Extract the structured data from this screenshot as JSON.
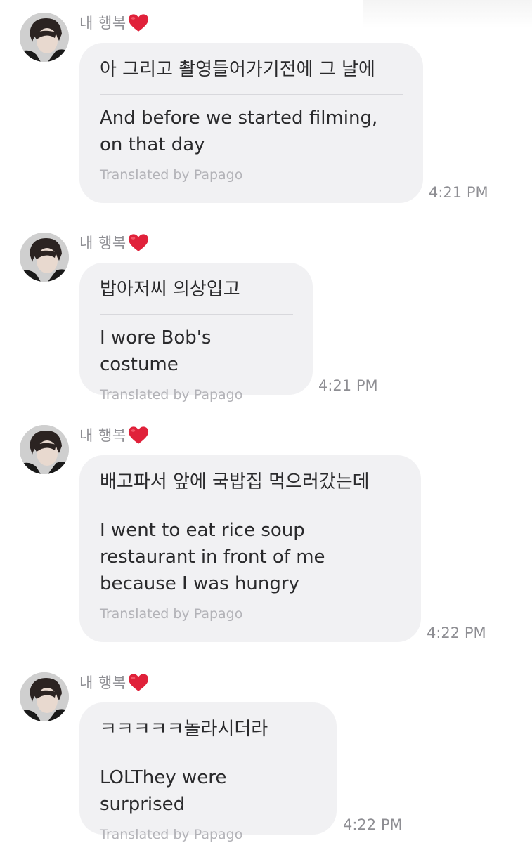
{
  "messages": [
    {
      "sender": "내 행복",
      "sender_emoji": "heart-icon",
      "original": "아 그리고 촬영들어가기전에 그 날에",
      "translation": "And before we started filming, on that day",
      "credit": "Translated by Papago",
      "time": "4:21 PM"
    },
    {
      "sender": "내 행복",
      "sender_emoji": "heart-icon",
      "original": "밥아저씨 의상입고",
      "translation": "I wore Bob's costume",
      "credit": "Translated by Papago",
      "time": "4:21 PM"
    },
    {
      "sender": "내 행복",
      "sender_emoji": "heart-icon",
      "original": "배고파서 앞에 국밥집 먹으러갔는데",
      "translation": "I went to eat rice soup restaurant in front of me because I was hungry",
      "credit": "Translated by Papago",
      "time": "4:22 PM"
    },
    {
      "sender": "내 행복",
      "sender_emoji": "heart-icon",
      "original": "ㅋㅋㅋㅋㅋ놀라시더라",
      "translation": "LOLThey were surprised",
      "credit": "Translated by Papago",
      "time": "4:22 PM"
    }
  ],
  "colors": {
    "bubble_background": "#f1f1f3",
    "text": "#2a2a2c",
    "meta_text": "#8e8e93",
    "credit_text": "#b3b3b8",
    "heart": "#e0213a"
  }
}
